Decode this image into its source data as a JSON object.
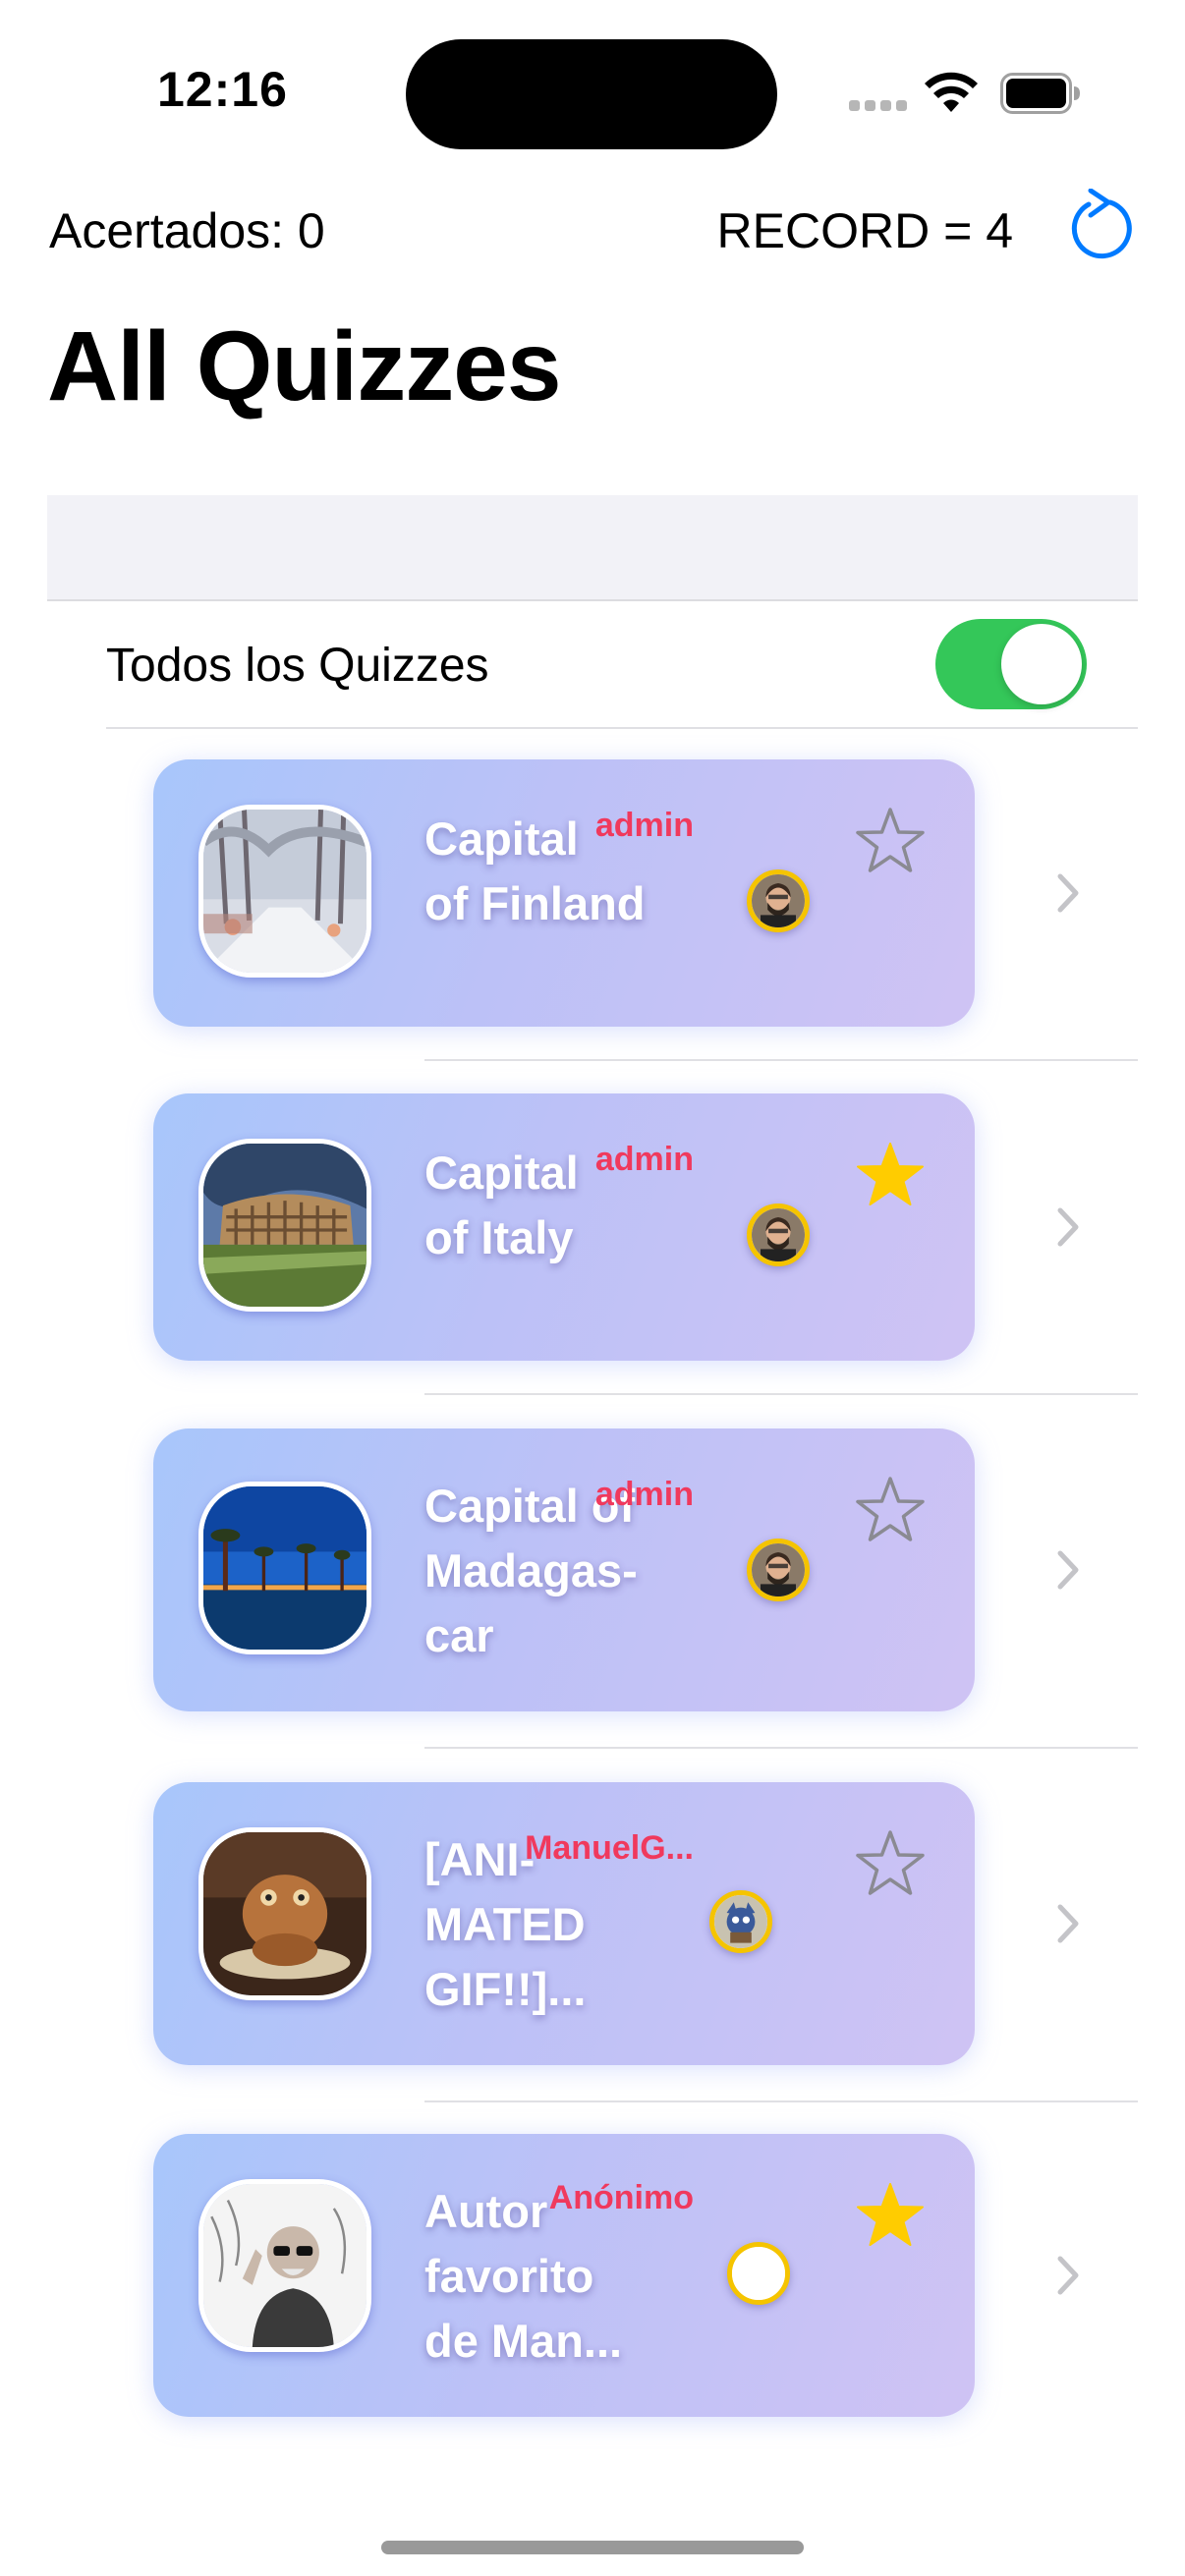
{
  "status_bar": {
    "time": "12:16"
  },
  "toolbar": {
    "score_label": "Acertados: 0",
    "record_label": "RECORD = 4",
    "reset_icon": "arrow-counterclockwise-icon"
  },
  "page": {
    "title": "All Quizzes"
  },
  "filter": {
    "label": "Todos los Quizzes",
    "toggle_on": true
  },
  "colors": {
    "accent": "#007aff",
    "toggle_on": "#34c759",
    "author_name": "#f0395d",
    "favorite_star": "#ffcc00",
    "card_gradient_start": "#a8c6fb",
    "card_gradient_end": "#cfc3f4"
  },
  "quizzes": [
    {
      "question": "Capital\nof Finland",
      "author": "admin",
      "favourite": false
    },
    {
      "question": "Capital\nof Italy",
      "author": "admin",
      "favourite": true
    },
    {
      "question": "Capital of\nMadagas-\ncar",
      "author": "admin",
      "favourite": false
    },
    {
      "question": "[ANI-\nMATED\nGIF!!]...",
      "author": "ManuelG...",
      "favourite": false
    },
    {
      "question": "Autor\nfavorito\nde Man...",
      "author": "Anónimo",
      "favourite": true
    }
  ]
}
